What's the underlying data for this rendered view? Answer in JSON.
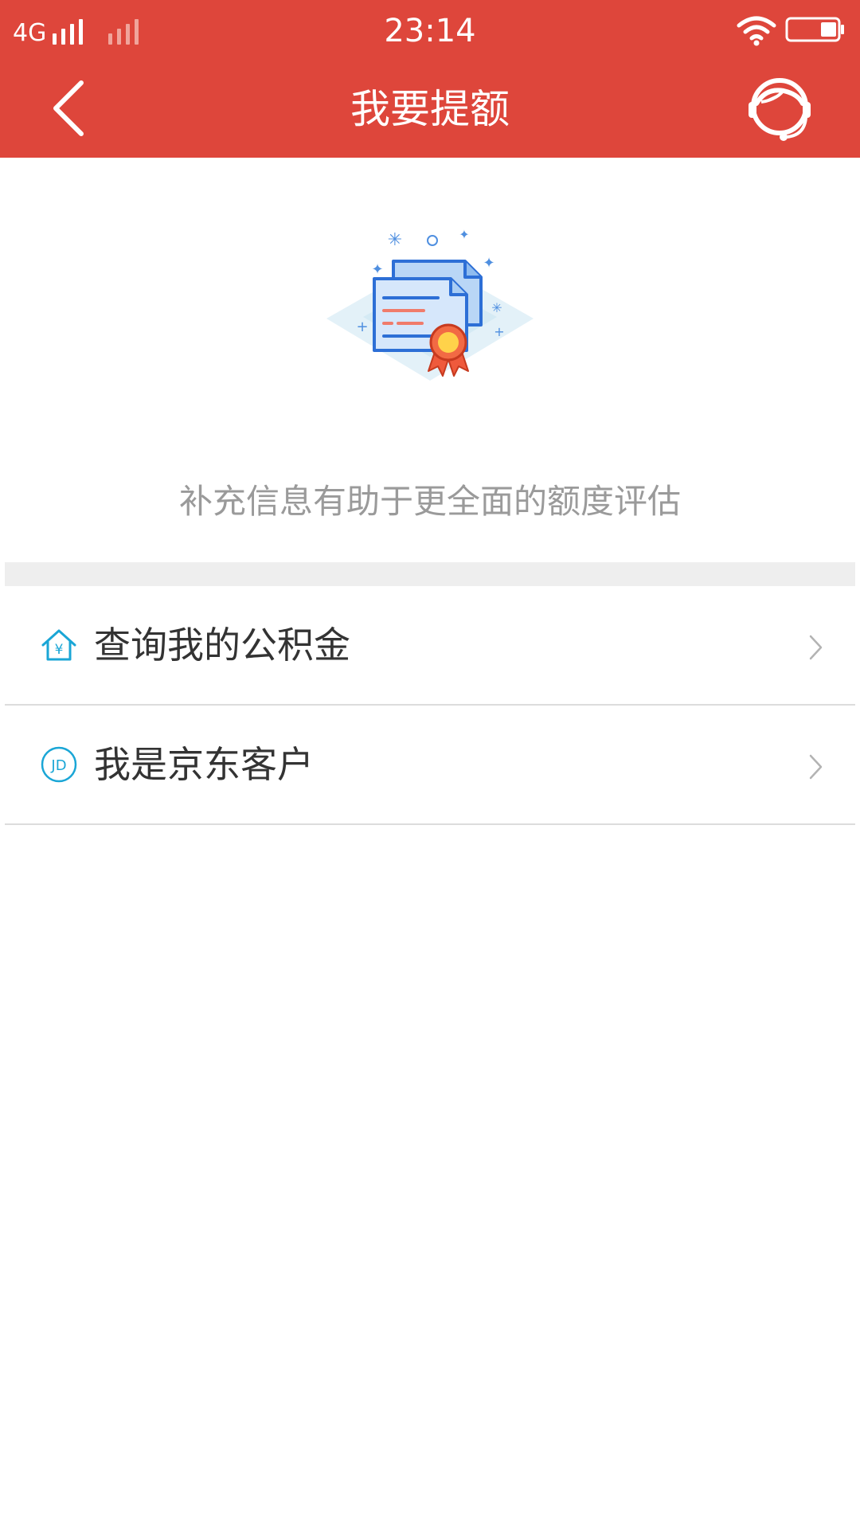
{
  "status_bar": {
    "carrier": "4G",
    "time": "23:14"
  },
  "nav": {
    "title": "我要提额",
    "icons": {
      "back": "chevron-left-icon",
      "service": "customer-service-icon"
    }
  },
  "hero": {
    "icon": "certificate-illustration",
    "subtitle": "补充信息有助于更全面的额度评估"
  },
  "list": {
    "items": [
      {
        "label": "查询我的公积金",
        "icon": "house-yuan-icon"
      },
      {
        "label": "我是京东客户",
        "icon": "jd-icon",
        "icon_text": "JD"
      }
    ]
  },
  "colors": {
    "header": "#de463b",
    "accent_icon": "#1aa6d6",
    "subtitle": "#9a9a9a"
  }
}
